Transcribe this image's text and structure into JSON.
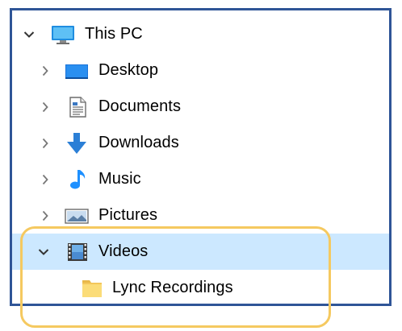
{
  "tree": {
    "this_pc": {
      "label": "This PC",
      "expanded": true,
      "icon": "monitor-icon"
    },
    "items": [
      {
        "label": "Desktop",
        "icon": "desktop-icon"
      },
      {
        "label": "Documents",
        "icon": "documents-icon"
      },
      {
        "label": "Downloads",
        "icon": "downloads-icon"
      },
      {
        "label": "Music",
        "icon": "music-icon"
      },
      {
        "label": "Pictures",
        "icon": "pictures-icon"
      }
    ],
    "videos": {
      "label": "Videos",
      "expanded": true,
      "selected": true,
      "icon": "videos-icon"
    },
    "videos_children": [
      {
        "label": "Lync Recordings",
        "icon": "folder-icon"
      }
    ]
  },
  "colors": {
    "frame_border": "#2f5597",
    "selected_row": "#cce8ff",
    "highlight_border": "#f5c960",
    "downloads_arrow": "#2b7fd6",
    "music_note": "#1e90ff",
    "folder": "#fbdc78"
  }
}
